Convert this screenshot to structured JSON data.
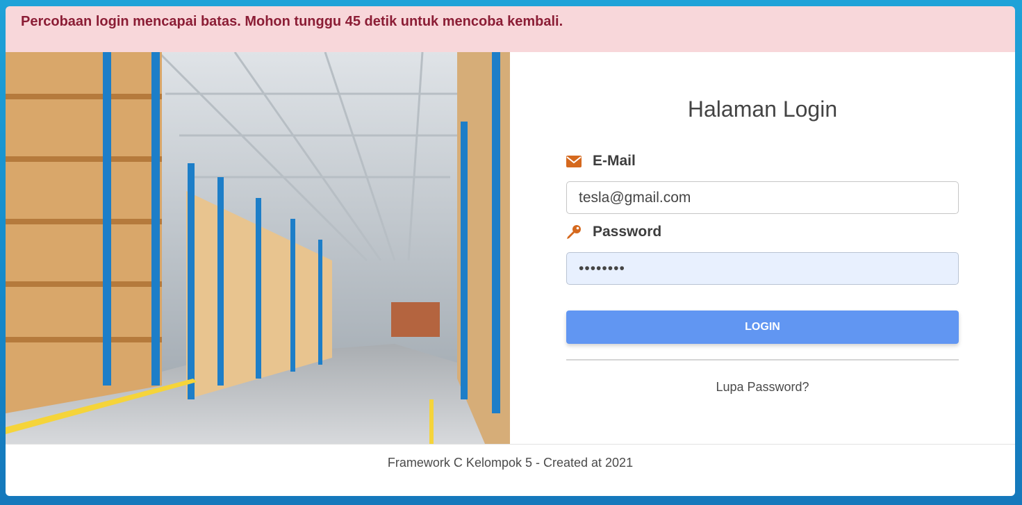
{
  "alert": {
    "message": "Percobaan login mencapai batas. Mohon tunggu 45 detik untuk mencoba kembali."
  },
  "login": {
    "title": "Halaman Login",
    "email_label": "E-Mail",
    "email_value": "tesla@gmail.com",
    "password_label": "Password",
    "password_value": "••••••••",
    "login_button": "LOGIN",
    "forgot_link": "Lupa Password?"
  },
  "footer": {
    "text": "Framework C Kelompok 5 - Created at 2021"
  },
  "icons": {
    "email": "envelope-icon",
    "password": "key-icon"
  },
  "colors": {
    "accent": "#6196f2",
    "icon": "#d5691e",
    "alert_bg": "#f8d7da",
    "alert_text": "#8b1d35"
  }
}
